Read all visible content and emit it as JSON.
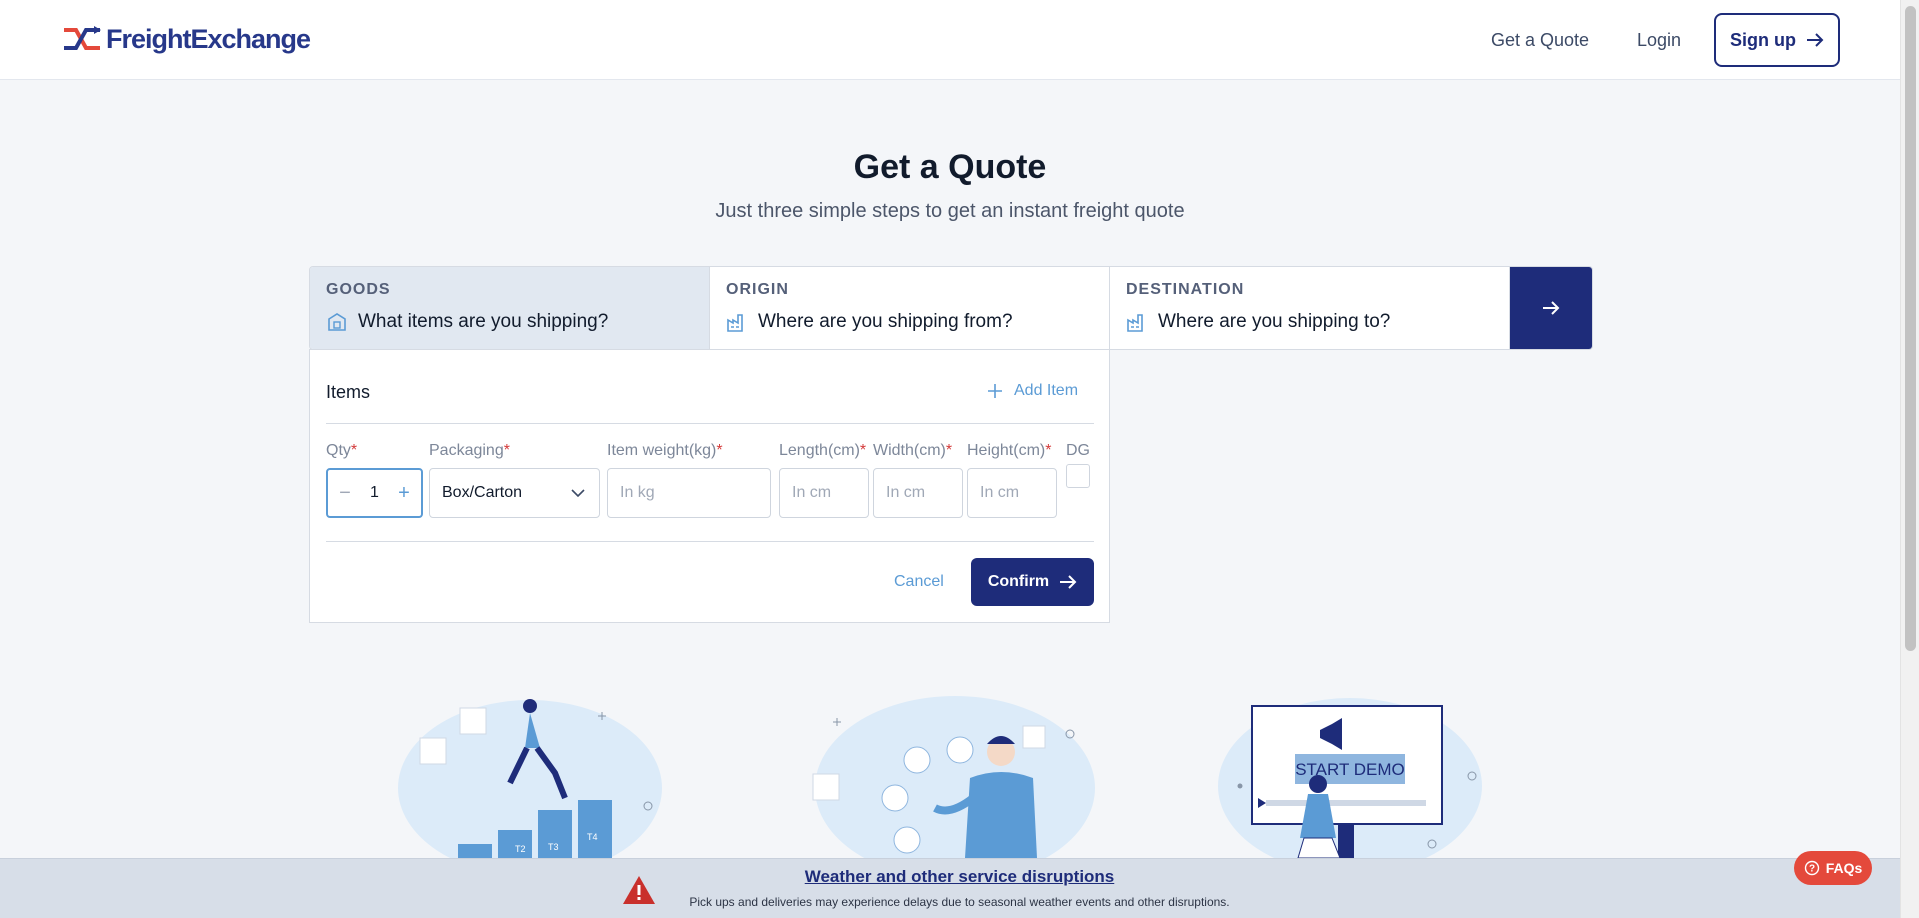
{
  "brand": {
    "name": "FreightExchange",
    "color": "#27388a",
    "accent": "#e4493b"
  },
  "nav": {
    "quote": "Get a Quote",
    "login": "Login",
    "signup": "Sign up"
  },
  "hero": {
    "title": "Get a Quote",
    "subtitle": "Just three simple steps to get an instant freight quote"
  },
  "steps": [
    {
      "title": "GOODS",
      "text": "What items are you shipping?",
      "icon": "box-icon",
      "active": true
    },
    {
      "title": "ORIGIN",
      "text": "Where are you shipping from?",
      "icon": "factory-icon"
    },
    {
      "title": "DESTINATION",
      "text": "Where are you shipping to?",
      "icon": "factory-icon"
    }
  ],
  "items": {
    "title": "Items",
    "add": "Add Item",
    "labels": {
      "qty": "Qty",
      "packaging": "Packaging",
      "weight": "Item weight(kg)",
      "length": "Length(cm)",
      "width": "Width(cm)",
      "height": "Height(cm)",
      "dg": "DG"
    },
    "req": "*",
    "qty_value": "1",
    "packaging_value": "Box/Carton",
    "placeholders": {
      "weight": "In kg",
      "length": "In cm",
      "width": "In cm",
      "height": "In cm"
    },
    "cancel": "Cancel",
    "confirm": "Confirm"
  },
  "illustrations": {
    "demo_label": "START DEMO",
    "bars": [
      "T2",
      "T3",
      "T4"
    ]
  },
  "banner": {
    "title": "Weather and other service disruptions",
    "text": "Pick ups and deliveries may experience delays due to seasonal weather events and other disruptions."
  },
  "faqs": "FAQs",
  "colors": {
    "primary": "#1e2c7a",
    "link": "#5b9bd5",
    "required": "#d43a3a"
  }
}
